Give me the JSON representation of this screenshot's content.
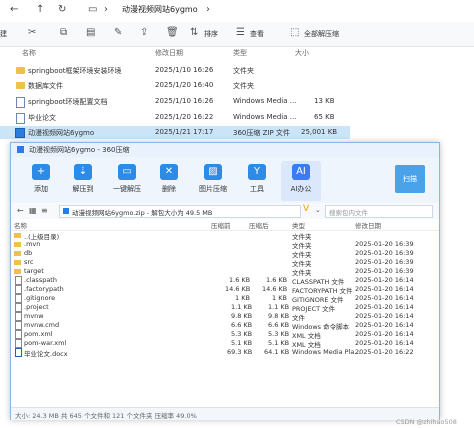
{
  "explorer": {
    "path_title": "动漫视频网站6ygmo",
    "cmd": {
      "left_cut": "建",
      "sort": "排序",
      "view": "查看",
      "extract_all": "全部解压缩"
    },
    "headers": {
      "name": "名称",
      "modified": "修改日期",
      "type": "类型",
      "size": "大小"
    },
    "rows": [
      {
        "name": "springboot框架环境安装环境",
        "modified": "2025/1/10 16:26",
        "type": "文件夹",
        "size": "",
        "icon": "folder-icon"
      },
      {
        "name": "数据库文件",
        "modified": "2025/1/20 16:40",
        "type": "文件夹",
        "size": "",
        "icon": "folder-icon"
      },
      {
        "name": "springboot环境配置文档",
        "modified": "2025/1/10 16:26",
        "type": "Windows Media ...",
        "size": "13 KB",
        "icon": "document-icon"
      },
      {
        "name": "毕业论文",
        "modified": "2025/1/20 16:22",
        "type": "Windows Media ...",
        "size": "65 KB",
        "icon": "document-icon"
      },
      {
        "name": "动漫视频网站6ygmo",
        "modified": "2025/1/21 17:17",
        "type": "360压缩 ZIP 文件",
        "size": "25,001 KB",
        "icon": "zip-icon"
      }
    ]
  },
  "zip": {
    "title": "动漫视频网站6ygmo - 360压缩",
    "tools": [
      {
        "label": "添加",
        "icon": "add-icon",
        "color": "#2b8be6"
      },
      {
        "label": "解压到",
        "icon": "extract-to-icon",
        "color": "#2b8be6"
      },
      {
        "label": "一键解压",
        "icon": "one-click-extract-icon",
        "color": "#2b8be6"
      },
      {
        "label": "删除",
        "icon": "delete-icon",
        "color": "#2b8be6"
      },
      {
        "label": "图片压缩",
        "icon": "image-compress-icon",
        "color": "#2b8be6"
      },
      {
        "label": "工具",
        "icon": "tools-icon",
        "color": "#2b8be6"
      },
      {
        "label": "AI办公",
        "icon": "ai-office-icon",
        "color": "#3a7cf5"
      }
    ],
    "scan_label": "扫描",
    "path_text": "动漫视频网站6ygmo.zip - 解包大小为 49.5 MB",
    "search_placeholder": "搜索包内文件",
    "headers": {
      "name": "名称",
      "compressed": "压缩前",
      "after": "压缩后",
      "type": "类型",
      "modified": "修改日期"
    },
    "rows": [
      {
        "name": "..(上级目录)",
        "compressed": "",
        "after": "",
        "type": "文件夹",
        "modified": "",
        "icon": "folder"
      },
      {
        "name": ".mvn",
        "compressed": "",
        "after": "",
        "type": "文件夹",
        "modified": "2025-01-20 16:39",
        "icon": "folder"
      },
      {
        "name": "db",
        "compressed": "",
        "after": "",
        "type": "文件夹",
        "modified": "2025-01-20 16:39",
        "icon": "folder"
      },
      {
        "name": "src",
        "compressed": "",
        "after": "",
        "type": "文件夹",
        "modified": "2025-01-20 16:39",
        "icon": "folder"
      },
      {
        "name": "target",
        "compressed": "",
        "after": "",
        "type": "文件夹",
        "modified": "2025-01-20 16:39",
        "icon": "folder"
      },
      {
        "name": ".classpath",
        "compressed": "1.6 KB",
        "after": "1.6 KB",
        "type": "CLASSPATH 文件",
        "modified": "2025-01-20 16:14",
        "icon": "doc"
      },
      {
        "name": ".factorypath",
        "compressed": "14.6 KB",
        "after": "14.6 KB",
        "type": "FACTORYPATH 文件",
        "modified": "2025-01-20 16:14",
        "icon": "doc"
      },
      {
        "name": ".gitignore",
        "compressed": "1 KB",
        "after": "1 KB",
        "type": "GITIGNORE 文件",
        "modified": "2025-01-20 16:14",
        "icon": "doc"
      },
      {
        "name": ".project",
        "compressed": "1.1 KB",
        "after": "1.1 KB",
        "type": "PROJECT 文件",
        "modified": "2025-01-20 16:14",
        "icon": "doc"
      },
      {
        "name": "mvnw",
        "compressed": "9.8 KB",
        "after": "9.8 KB",
        "type": "文件",
        "modified": "2025-01-20 16:14",
        "icon": "doc"
      },
      {
        "name": "mvnw.cmd",
        "compressed": "6.6 KB",
        "after": "6.6 KB",
        "type": "Windows 命令脚本",
        "modified": "2025-01-20 16:14",
        "icon": "doc"
      },
      {
        "name": "pom.xml",
        "compressed": "5.3 KB",
        "after": "5.3 KB",
        "type": "XML 文档",
        "modified": "2025-01-20 16:14",
        "icon": "doc"
      },
      {
        "name": "pom-war.xml",
        "compressed": "5.1 KB",
        "after": "5.1 KB",
        "type": "XML 文档",
        "modified": "2025-01-20 16:14",
        "icon": "doc"
      },
      {
        "name": "毕业论文.docx",
        "compressed": "69.3 KB",
        "after": "64.1 KB",
        "type": "Windows Media Pla...",
        "modified": "2025-01-20 16:22",
        "icon": "doc"
      }
    ],
    "status": "大小: 24.3 MB 共 645 个文件和 121 个文件夹 压缩率 49.0%"
  },
  "watermark": "CSDN @zhihao508"
}
